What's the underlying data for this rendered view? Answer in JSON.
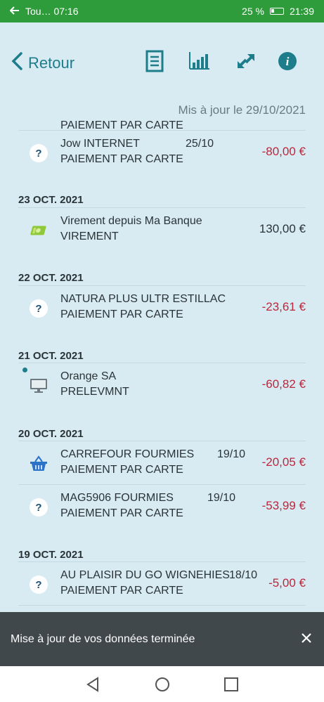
{
  "status": {
    "left_text": "Tou… 07:16",
    "battery": "25 %",
    "time": "21:39"
  },
  "nav": {
    "back_label": "Retour",
    "icons": [
      "document-icon",
      "bar-chart-icon",
      "transfer-arrows-icon",
      "info-icon"
    ]
  },
  "updated_text": "Mis à jour le 29/10/2021",
  "partial_row_text": "PAIEMENT PAR CARTE",
  "sections": [
    {
      "date": "",
      "rows": [
        {
          "label": "Jow INTERNET",
          "date": "25/10",
          "type": "PAIEMENT PAR CARTE",
          "amount": "-80,00 €",
          "icon": "question-icon"
        }
      ]
    },
    {
      "date": "23 OCT. 2021",
      "rows": [
        {
          "label": "Virement depuis Ma Banque",
          "date": "",
          "type": "VIREMENT",
          "amount": "130,00 €",
          "icon": "banknote-icon"
        }
      ]
    },
    {
      "date": "22 OCT. 2021",
      "rows": [
        {
          "label": "NATURA PLUS ULTR ESTILLAC",
          "date": "",
          "type": "PAIEMENT PAR CARTE",
          "amount": "-23,61 €",
          "icon": "question-icon"
        }
      ]
    },
    {
      "date": "21 OCT. 2021",
      "rows": [
        {
          "label": "Orange SA",
          "date": "",
          "type": "PRELEVMNT",
          "amount": "-60,82 €",
          "icon": "monitor-icon"
        }
      ]
    },
    {
      "date": "20 OCT. 2021",
      "rows": [
        {
          "label": "CARREFOUR FOURMIES",
          "date": "19/10",
          "type": "PAIEMENT PAR CARTE",
          "amount": "-20,05 €",
          "icon": "basket-icon"
        },
        {
          "label": "MAG5906 FOURMIES",
          "date": "19/10",
          "type": "PAIEMENT PAR CARTE",
          "amount": "-53,99 €",
          "icon": "question-icon"
        }
      ]
    },
    {
      "date": "19 OCT. 2021",
      "rows": [
        {
          "label": "AU PLAISIR DU GO WIGNEHIES",
          "date": "18/10",
          "type": "PAIEMENT PAR CARTE",
          "amount": "-5,00 €",
          "icon": "question-icon"
        }
      ]
    }
  ],
  "toast": {
    "message": "Mise à jour de vos données terminée"
  },
  "colors": {
    "status_bar": "#2f9c3c",
    "accent": "#1d7d8a",
    "negative": "#c0243a",
    "background": "#d8ebf2"
  }
}
